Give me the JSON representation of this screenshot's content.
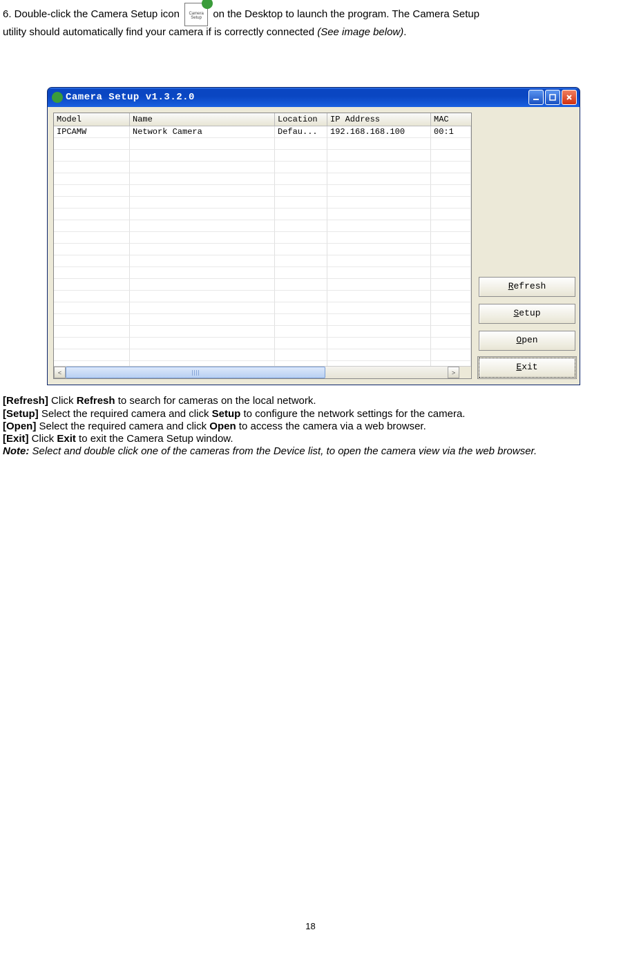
{
  "intro": {
    "prefix": "6. Double-click the Camera Setup icon ",
    "suffix1": " on the Desktop to launch the program. The Camera Setup",
    "line2a": "utility should automatically find your camera if is correctly connected ",
    "line2b": "(See image below)",
    "dot": "."
  },
  "window": {
    "title": "Camera Setup v1.3.2.0",
    "columns": {
      "model": "Model",
      "name": "Name",
      "location": "Location",
      "ip": "IP Address",
      "mac": "MAC"
    },
    "row": {
      "model": "IPCAMW",
      "name": "Network Camera",
      "location": "Defau...",
      "ip": "192.168.168.100",
      "mac": "00:1"
    },
    "buttons": {
      "refresh_pre": "R",
      "refresh_suf": "efresh",
      "setup_pre": "S",
      "setup_suf": "etup",
      "open_pre": "O",
      "open_suf": "pen",
      "exit_pre": "E",
      "exit_suf": "xit"
    },
    "scroll": {
      "left": "<",
      "right": ">"
    }
  },
  "after": {
    "refresh_tag": "[Refresh]",
    "refresh_txt": " Click ",
    "refresh_b": "Refresh",
    "refresh_end": " to search for cameras on the local network.",
    "setup_tag": "[Setup]",
    "setup_txt": " Select the required camera and click ",
    "setup_b": "Setup",
    "setup_end": " to configure the network settings for the camera.",
    "open_tag": "[Open]",
    "open_txt": " Select the required camera and click ",
    "open_b": "Open",
    "open_end": " to access the camera via a web browser.",
    "exit_tag": "[Exit]",
    "exit_txt": " Click ",
    "exit_b": "Exit",
    "exit_end": " to exit the Camera Setup window.",
    "note_tag": "Note:",
    "note_txt": " Select and double click one of the cameras from the Device list, to open the camera view via the web browser."
  },
  "page_number": "18",
  "blank_rows": 20
}
